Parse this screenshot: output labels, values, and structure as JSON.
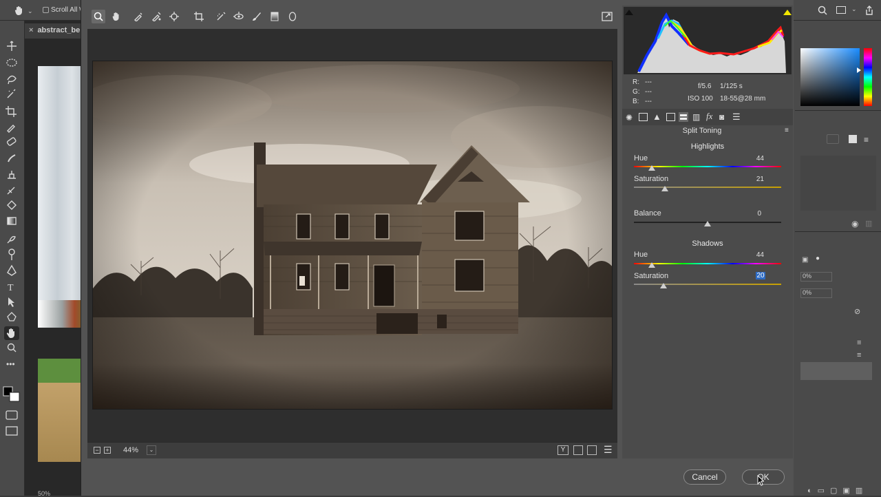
{
  "ps": {
    "options": {
      "scroll_all": "Scroll All W"
    },
    "document_tab": "abstract_be",
    "zoom_readout": "50%",
    "panel_pct_1": "0%",
    "panel_pct_2": "0%"
  },
  "acr": {
    "metadata": {
      "r_label": "R:",
      "r_value": "---",
      "g_label": "G:",
      "g_value": "---",
      "b_label": "B:",
      "b_value": "---",
      "aperture": "f/5.6",
      "shutter": "1/125 s",
      "iso": "ISO 100",
      "lens": "18-55@28 mm"
    },
    "panel_title": "Split Toning",
    "highlights": {
      "heading": "Highlights",
      "hue_label": "Hue",
      "hue_value": "44",
      "hue": 44,
      "sat_label": "Saturation",
      "sat_value": "21",
      "sat": 21
    },
    "balance": {
      "label": "Balance",
      "value": "0",
      "num": 0
    },
    "shadows": {
      "heading": "Shadows",
      "hue_label": "Hue",
      "hue_value": "44",
      "hue": 44,
      "sat_label": "Saturation",
      "sat_value": "20",
      "sat": 20
    },
    "zoom": "44%",
    "buttons": {
      "cancel": "Cancel",
      "ok": "OK"
    },
    "colors": {
      "accent": "#2d6bc4",
      "highlight_clip": "#f2e600"
    }
  }
}
